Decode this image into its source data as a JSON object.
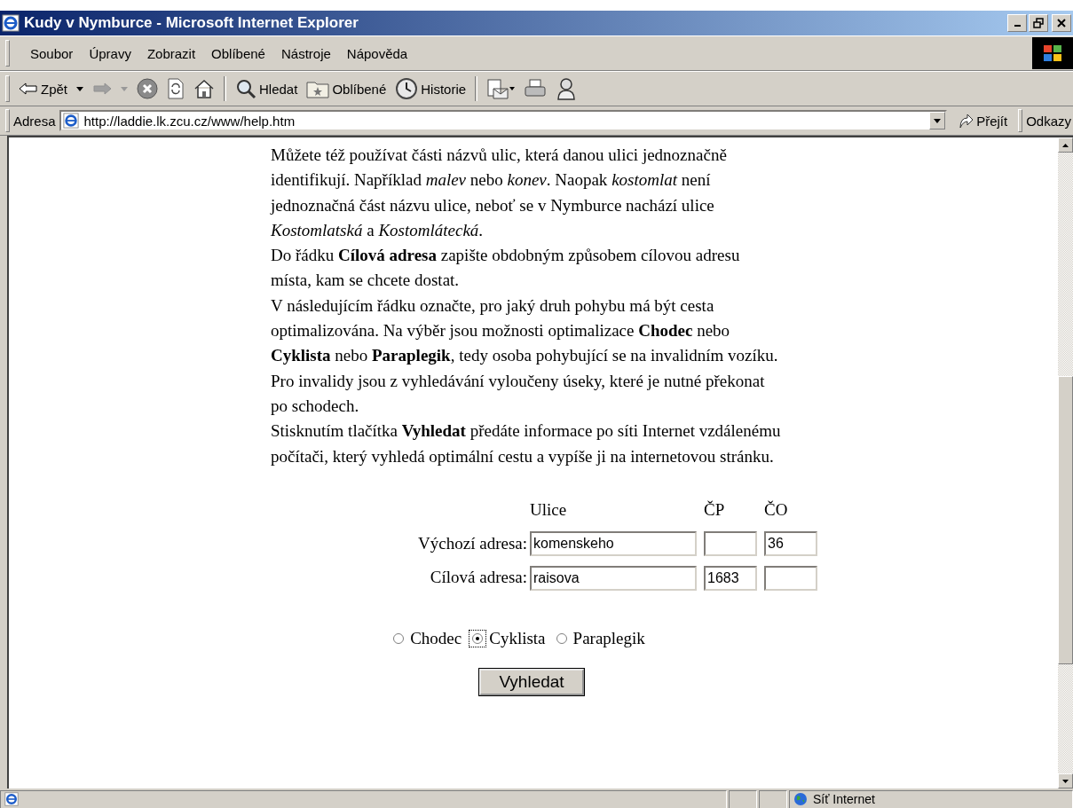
{
  "window": {
    "title": "Kudy v Nymburce - Microsoft Internet Explorer"
  },
  "menu": [
    "Soubor",
    "Úpravy",
    "Zobrazit",
    "Oblíbené",
    "Nástroje",
    "Nápověda"
  ],
  "toolbar": [
    {
      "kind": "back",
      "label": "Zpět"
    },
    {
      "kind": "forward"
    },
    {
      "kind": "stop"
    },
    {
      "kind": "refresh"
    },
    {
      "kind": "home"
    },
    {
      "kind": "separator"
    },
    {
      "kind": "search",
      "label": "Hledat"
    },
    {
      "kind": "favorites",
      "label": "Oblíbené"
    },
    {
      "kind": "history",
      "label": "Historie"
    },
    {
      "kind": "separator"
    },
    {
      "kind": "mail"
    },
    {
      "kind": "print"
    },
    {
      "kind": "messenger"
    }
  ],
  "address_bar": {
    "label": "Adresa",
    "url": "http://laddie.lk.zcu.cz/www/help.htm",
    "go": "Přejít",
    "links": "Odkazy"
  },
  "page": {
    "paragraphs": [
      "Můžete též používat části názvů ulic, která danou ulici jednoznačně identifikují. Například *malev* nebo *konev*. Naopak *kostomlat* není jednoznačná část názvu ulice, neboť se v Nymburce nachází ulice *Kostomlatská* a *Kostomlátecká*.",
      "Do řádku **Cílová adresa** zapište obdobným způsobem cílovou adresu místa, kam se chcete dostat.",
      "V následujícím řádku označte, pro jaký druh pohybu má být cesta optimalizována. Na výběr jsou možnosti optimalizace **Chodec** nebo **Cyklista** nebo **Paraplegik**, tedy osoba pohybující se na invalidním vozíku. Pro invalidy jsou z vyhledávání vyloučeny úseky, které je nutné překonat po schodech.",
      "Stisknutím tlačítka **Vyhledat** předáte informace po síti Internet vzdálenému počítači, který vyhledá optimální cestu a vypíše ji na internetovou stránku."
    ],
    "form": {
      "columns": [
        "Ulice",
        "ČP",
        "ČO"
      ],
      "rows": [
        {
          "label": "Výchozí adresa:",
          "street": "komenskeho",
          "cp": "",
          "co": "36"
        },
        {
          "label": "Cílová adresa:",
          "street": "raisova",
          "cp": "1683",
          "co": ""
        }
      ],
      "modes": [
        {
          "label": "Chodec",
          "selected": false,
          "focused": false
        },
        {
          "label": "Cyklista",
          "selected": true,
          "focused": true
        },
        {
          "label": "Paraplegik",
          "selected": false,
          "focused": false
        }
      ],
      "submit": "Vyhledat"
    }
  },
  "status_bar": {
    "zone": "Síť Internet"
  }
}
